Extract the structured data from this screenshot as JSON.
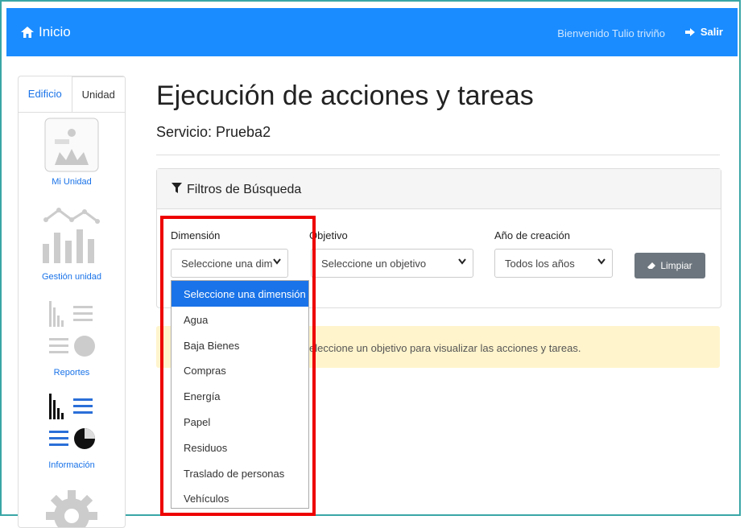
{
  "topbar": {
    "brand": "Inicio",
    "welcome": "Bienvenido Tulio triviño",
    "logout": "Salir"
  },
  "sidebar": {
    "tabs": [
      "Edificio",
      "Unidad"
    ],
    "items": [
      {
        "label": "Mi Unidad",
        "icon": "building-icon"
      },
      {
        "label": "Gestión unidad",
        "icon": "line-bar-chart-icon"
      },
      {
        "label": "Reportes",
        "icon": "report-charts-icon"
      },
      {
        "label": "Información",
        "icon": "info-charts-icon"
      },
      {
        "label": "",
        "icon": "gear-icon"
      }
    ]
  },
  "page": {
    "title": "Ejecución de acciones y tareas",
    "subtitle": "Servicio: Prueba2"
  },
  "filters": {
    "header": "Filtros de Búsqueda",
    "dimension_label": "Dimensión",
    "dimension_value": "Seleccione una dim",
    "objective_label": "Objetivo",
    "objective_value": "Seleccione un objetivo",
    "year_label": "Año de creación",
    "year_value": "Todos los años",
    "clear_button": "Limpiar"
  },
  "alert": {
    "text": "eleccione un objetivo para visualizar las acciones y tareas."
  },
  "dropdown": {
    "options": [
      "Seleccione una dimensión",
      "Agua",
      "Baja Bienes",
      "Compras",
      "Energía",
      "Papel",
      "Residuos",
      "Traslado de personas",
      "Vehículos"
    ],
    "selected_index": 0
  },
  "colors": {
    "topbar": "#1a8cff",
    "highlight": "#e00000",
    "alert_bg": "#fff4cc",
    "selected_option": "#1a73e8"
  }
}
